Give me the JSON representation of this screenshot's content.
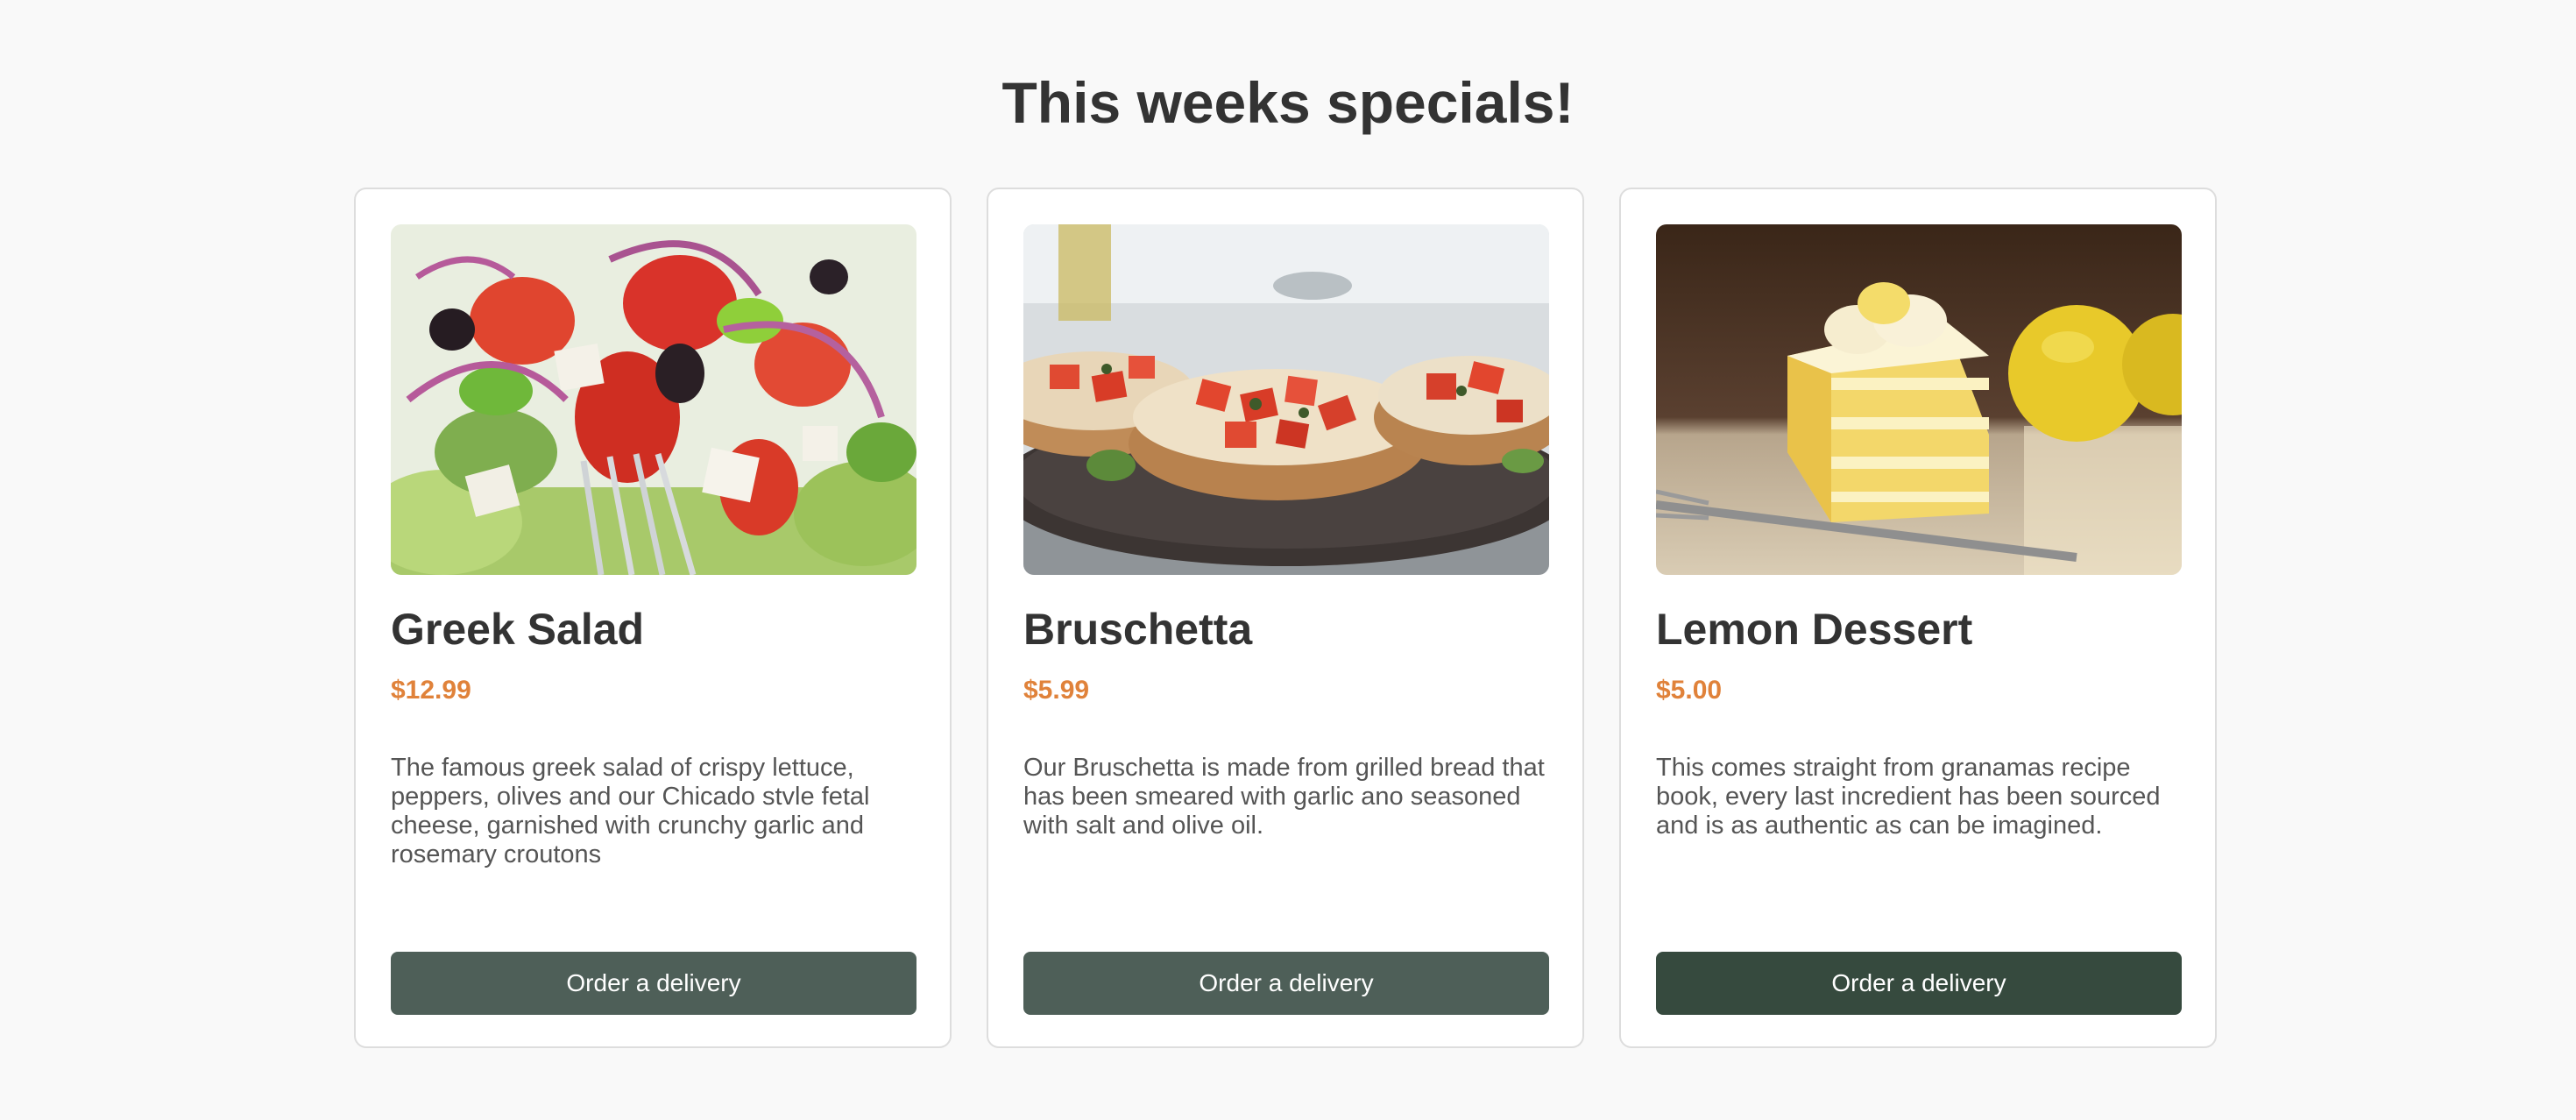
{
  "page": {
    "title": "This weeks specials!"
  },
  "colors": {
    "background": "#f9f9f9",
    "price": "#e0823a",
    "button": "#4e5f58",
    "button_hover": "#364a3e"
  },
  "specials": [
    {
      "image": "greek-salad-photo",
      "title": "Greek Salad",
      "price": "$12.99",
      "description": "The famous greek salad of crispy lettuce, peppers, olives and our Chicado stvle fetal cheese, garnished with crunchy garlic and rosemary croutons",
      "button_label": "Order a delivery"
    },
    {
      "image": "bruschetta-photo",
      "title": "Bruschetta",
      "price": "$5.99",
      "description": "Our Bruschetta is made from grilled bread that has been smeared with garlic ano seasoned with salt and olive oil.",
      "button_label": "Order a delivery"
    },
    {
      "image": "lemon-dessert-photo",
      "title": "Lemon Dessert",
      "price": "$5.00",
      "description": "This comes straight from granamas recipe book, every last incredient has been sourced and is as authentic as can be imagined.",
      "button_label": "Order a delivery"
    }
  ]
}
